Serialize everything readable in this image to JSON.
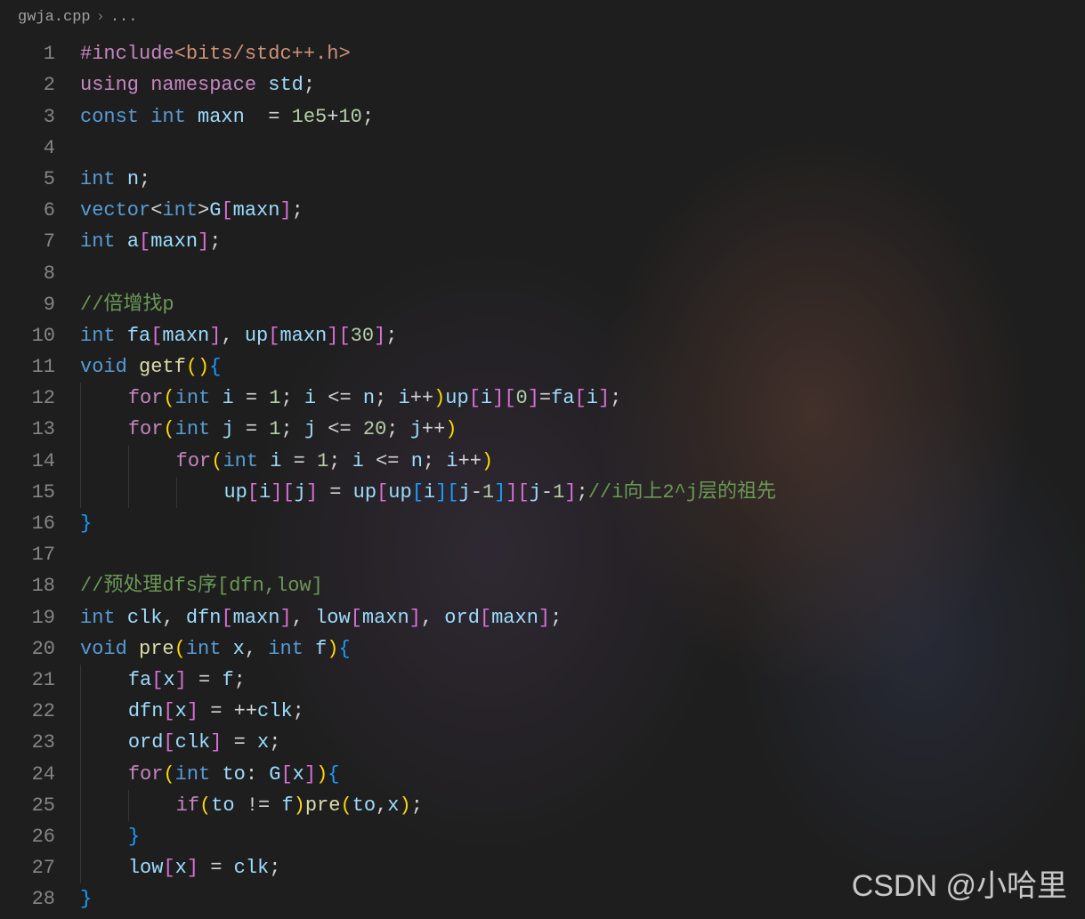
{
  "breadcrumb": {
    "file": "gwja.cpp",
    "separator": "›",
    "current": "..."
  },
  "watermark": "CSDN @小哈里",
  "code": {
    "lines": [
      {
        "n": 1,
        "tokens": [
          [
            "#include",
            "keyword"
          ],
          [
            "<bits/stdc++.h>",
            "string"
          ]
        ]
      },
      {
        "n": 2,
        "tokens": [
          [
            "using",
            "keyword"
          ],
          [
            " ",
            ""
          ],
          [
            "namespace",
            "keyword"
          ],
          [
            " ",
            ""
          ],
          [
            "std",
            "var"
          ],
          [
            ";",
            "punct"
          ]
        ]
      },
      {
        "n": 3,
        "tokens": [
          [
            "const",
            "type"
          ],
          [
            " ",
            ""
          ],
          [
            "int",
            "type"
          ],
          [
            " ",
            ""
          ],
          [
            "maxn",
            "var"
          ],
          [
            "  = ",
            "op"
          ],
          [
            "1e5",
            "number"
          ],
          [
            "+",
            "op"
          ],
          [
            "10",
            "number"
          ],
          [
            ";",
            "punct"
          ]
        ]
      },
      {
        "n": 4,
        "tokens": []
      },
      {
        "n": 5,
        "tokens": [
          [
            "int",
            "type"
          ],
          [
            " ",
            ""
          ],
          [
            "n",
            "var"
          ],
          [
            ";",
            "punct"
          ]
        ]
      },
      {
        "n": 6,
        "tokens": [
          [
            "vector",
            "type"
          ],
          [
            "<",
            "op"
          ],
          [
            "int",
            "type"
          ],
          [
            ">",
            "op"
          ],
          [
            "G",
            "var"
          ],
          [
            "[",
            "bracket"
          ],
          [
            "maxn",
            "var"
          ],
          [
            "]",
            "bracket"
          ],
          [
            ";",
            "punct"
          ]
        ]
      },
      {
        "n": 7,
        "tokens": [
          [
            "int",
            "type"
          ],
          [
            " ",
            ""
          ],
          [
            "a",
            "var"
          ],
          [
            "[",
            "bracket"
          ],
          [
            "maxn",
            "var"
          ],
          [
            "]",
            "bracket"
          ],
          [
            ";",
            "punct"
          ]
        ]
      },
      {
        "n": 8,
        "tokens": []
      },
      {
        "n": 9,
        "tokens": [
          [
            "//倍增找p",
            "comment"
          ]
        ]
      },
      {
        "n": 10,
        "tokens": [
          [
            "int",
            "type"
          ],
          [
            " ",
            ""
          ],
          [
            "fa",
            "var"
          ],
          [
            "[",
            "bracket"
          ],
          [
            "maxn",
            "var"
          ],
          [
            "]",
            "bracket"
          ],
          [
            ", ",
            "punct"
          ],
          [
            "up",
            "var"
          ],
          [
            "[",
            "bracket"
          ],
          [
            "maxn",
            "var"
          ],
          [
            "]",
            "bracket"
          ],
          [
            "[",
            "bracket"
          ],
          [
            "30",
            "number"
          ],
          [
            "]",
            "bracket"
          ],
          [
            ";",
            "punct"
          ]
        ]
      },
      {
        "n": 11,
        "tokens": [
          [
            "void",
            "type"
          ],
          [
            " ",
            ""
          ],
          [
            "getf",
            "func"
          ],
          [
            "(",
            "paren"
          ],
          [
            ")",
            "paren"
          ],
          [
            "{",
            "brace"
          ]
        ]
      },
      {
        "n": 12,
        "indent": 1,
        "tokens": [
          [
            "for",
            "keyword"
          ],
          [
            "(",
            "paren"
          ],
          [
            "int",
            "type"
          ],
          [
            " ",
            ""
          ],
          [
            "i",
            "var"
          ],
          [
            " = ",
            "op"
          ],
          [
            "1",
            "number"
          ],
          [
            "; ",
            "punct"
          ],
          [
            "i",
            "var"
          ],
          [
            " <= ",
            "op"
          ],
          [
            "n",
            "var"
          ],
          [
            "; ",
            "punct"
          ],
          [
            "i",
            "var"
          ],
          [
            "++",
            "op"
          ],
          [
            ")",
            "paren"
          ],
          [
            "up",
            "var"
          ],
          [
            "[",
            "bracket"
          ],
          [
            "i",
            "var"
          ],
          [
            "]",
            "bracket"
          ],
          [
            "[",
            "bracket"
          ],
          [
            "0",
            "number"
          ],
          [
            "]",
            "bracket"
          ],
          [
            "=",
            "op"
          ],
          [
            "fa",
            "var"
          ],
          [
            "[",
            "bracket"
          ],
          [
            "i",
            "var"
          ],
          [
            "]",
            "bracket"
          ],
          [
            ";",
            "punct"
          ]
        ]
      },
      {
        "n": 13,
        "indent": 1,
        "tokens": [
          [
            "for",
            "keyword"
          ],
          [
            "(",
            "paren"
          ],
          [
            "int",
            "type"
          ],
          [
            " ",
            ""
          ],
          [
            "j",
            "var"
          ],
          [
            " = ",
            "op"
          ],
          [
            "1",
            "number"
          ],
          [
            "; ",
            "punct"
          ],
          [
            "j",
            "var"
          ],
          [
            " <= ",
            "op"
          ],
          [
            "20",
            "number"
          ],
          [
            "; ",
            "punct"
          ],
          [
            "j",
            "var"
          ],
          [
            "++",
            "op"
          ],
          [
            ")",
            "paren"
          ]
        ]
      },
      {
        "n": 14,
        "indent": 2,
        "tokens": [
          [
            "for",
            "keyword"
          ],
          [
            "(",
            "paren"
          ],
          [
            "int",
            "type"
          ],
          [
            " ",
            ""
          ],
          [
            "i",
            "var"
          ],
          [
            " = ",
            "op"
          ],
          [
            "1",
            "number"
          ],
          [
            "; ",
            "punct"
          ],
          [
            "i",
            "var"
          ],
          [
            " <= ",
            "op"
          ],
          [
            "n",
            "var"
          ],
          [
            "; ",
            "punct"
          ],
          [
            "i",
            "var"
          ],
          [
            "++",
            "op"
          ],
          [
            ")",
            "paren"
          ]
        ]
      },
      {
        "n": 15,
        "indent": 3,
        "tokens": [
          [
            "up",
            "var"
          ],
          [
            "[",
            "bracket"
          ],
          [
            "i",
            "var"
          ],
          [
            "]",
            "bracket"
          ],
          [
            "[",
            "bracket"
          ],
          [
            "j",
            "var"
          ],
          [
            "]",
            "bracket"
          ],
          [
            " = ",
            "op"
          ],
          [
            "up",
            "var"
          ],
          [
            "[",
            "bracket"
          ],
          [
            "up",
            "var"
          ],
          [
            "[",
            "brace"
          ],
          [
            "i",
            "var"
          ],
          [
            "]",
            "brace"
          ],
          [
            "[",
            "brace"
          ],
          [
            "j",
            "var"
          ],
          [
            "-",
            "op"
          ],
          [
            "1",
            "number"
          ],
          [
            "]",
            "brace"
          ],
          [
            "]",
            "bracket"
          ],
          [
            "[",
            "bracket"
          ],
          [
            "j",
            "var"
          ],
          [
            "-",
            "op"
          ],
          [
            "1",
            "number"
          ],
          [
            "]",
            "bracket"
          ],
          [
            ";",
            "punct"
          ],
          [
            "//i向上2^j层的祖先",
            "comment"
          ]
        ]
      },
      {
        "n": 16,
        "tokens": [
          [
            "}",
            "brace"
          ]
        ]
      },
      {
        "n": 17,
        "tokens": []
      },
      {
        "n": 18,
        "tokens": [
          [
            "//预处理dfs序[dfn,low]",
            "comment"
          ]
        ]
      },
      {
        "n": 19,
        "tokens": [
          [
            "int",
            "type"
          ],
          [
            " ",
            ""
          ],
          [
            "clk",
            "var"
          ],
          [
            ", ",
            "punct"
          ],
          [
            "dfn",
            "var"
          ],
          [
            "[",
            "bracket"
          ],
          [
            "maxn",
            "var"
          ],
          [
            "]",
            "bracket"
          ],
          [
            ", ",
            "punct"
          ],
          [
            "low",
            "var"
          ],
          [
            "[",
            "bracket"
          ],
          [
            "maxn",
            "var"
          ],
          [
            "]",
            "bracket"
          ],
          [
            ", ",
            "punct"
          ],
          [
            "ord",
            "var"
          ],
          [
            "[",
            "bracket"
          ],
          [
            "maxn",
            "var"
          ],
          [
            "]",
            "bracket"
          ],
          [
            ";",
            "punct"
          ]
        ]
      },
      {
        "n": 20,
        "tokens": [
          [
            "void",
            "type"
          ],
          [
            " ",
            ""
          ],
          [
            "pre",
            "func"
          ],
          [
            "(",
            "paren"
          ],
          [
            "int",
            "type"
          ],
          [
            " ",
            ""
          ],
          [
            "x",
            "var"
          ],
          [
            ", ",
            "punct"
          ],
          [
            "int",
            "type"
          ],
          [
            " ",
            ""
          ],
          [
            "f",
            "var"
          ],
          [
            ")",
            "paren"
          ],
          [
            "{",
            "brace"
          ]
        ]
      },
      {
        "n": 21,
        "indent": 1,
        "tokens": [
          [
            "fa",
            "var"
          ],
          [
            "[",
            "bracket"
          ],
          [
            "x",
            "var"
          ],
          [
            "]",
            "bracket"
          ],
          [
            " = ",
            "op"
          ],
          [
            "f",
            "var"
          ],
          [
            ";",
            "punct"
          ]
        ]
      },
      {
        "n": 22,
        "indent": 1,
        "tokens": [
          [
            "dfn",
            "var"
          ],
          [
            "[",
            "bracket"
          ],
          [
            "x",
            "var"
          ],
          [
            "]",
            "bracket"
          ],
          [
            " = ++",
            "op"
          ],
          [
            "clk",
            "var"
          ],
          [
            ";",
            "punct"
          ]
        ]
      },
      {
        "n": 23,
        "indent": 1,
        "tokens": [
          [
            "ord",
            "var"
          ],
          [
            "[",
            "bracket"
          ],
          [
            "clk",
            "var"
          ],
          [
            "]",
            "bracket"
          ],
          [
            " = ",
            "op"
          ],
          [
            "x",
            "var"
          ],
          [
            ";",
            "punct"
          ]
        ]
      },
      {
        "n": 24,
        "indent": 1,
        "tokens": [
          [
            "for",
            "keyword"
          ],
          [
            "(",
            "paren"
          ],
          [
            "int",
            "type"
          ],
          [
            " ",
            ""
          ],
          [
            "to",
            "var"
          ],
          [
            ": ",
            "op"
          ],
          [
            "G",
            "var"
          ],
          [
            "[",
            "bracket"
          ],
          [
            "x",
            "var"
          ],
          [
            "]",
            "bracket"
          ],
          [
            ")",
            "paren"
          ],
          [
            "{",
            "brace"
          ]
        ]
      },
      {
        "n": 25,
        "indent": 2,
        "tokens": [
          [
            "if",
            "keyword"
          ],
          [
            "(",
            "paren"
          ],
          [
            "to",
            "var"
          ],
          [
            " != ",
            "op"
          ],
          [
            "f",
            "var"
          ],
          [
            ")",
            "paren"
          ],
          [
            "pre",
            "func"
          ],
          [
            "(",
            "paren"
          ],
          [
            "to",
            "var"
          ],
          [
            ",",
            "punct"
          ],
          [
            "x",
            "var"
          ],
          [
            ")",
            "paren"
          ],
          [
            ";",
            "punct"
          ]
        ]
      },
      {
        "n": 26,
        "indent": 1,
        "tokens": [
          [
            "}",
            "brace"
          ]
        ]
      },
      {
        "n": 27,
        "indent": 1,
        "tokens": [
          [
            "low",
            "var"
          ],
          [
            "[",
            "bracket"
          ],
          [
            "x",
            "var"
          ],
          [
            "]",
            "bracket"
          ],
          [
            " = ",
            "op"
          ],
          [
            "clk",
            "var"
          ],
          [
            ";",
            "punct"
          ]
        ]
      },
      {
        "n": 28,
        "tokens": [
          [
            "}",
            "brace"
          ]
        ]
      }
    ]
  }
}
